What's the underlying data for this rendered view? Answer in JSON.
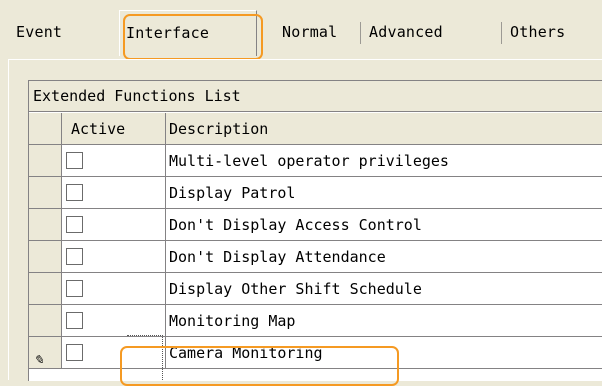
{
  "tabs": [
    {
      "label": "Event"
    },
    {
      "label": "Interface"
    },
    {
      "label": "Normal"
    },
    {
      "label": "Advanced"
    },
    {
      "label": "Others"
    }
  ],
  "grid": {
    "caption": "Extended Functions List",
    "columns": {
      "active": "Active",
      "description": "Description"
    },
    "rows": [
      {
        "description": "Multi-level operator privileges",
        "checked": false
      },
      {
        "description": "Display Patrol",
        "checked": false
      },
      {
        "description": "Don't Display Access Control",
        "checked": false
      },
      {
        "description": "Don't Display Attendance",
        "checked": false
      },
      {
        "description": "Display Other Shift Schedule",
        "checked": false
      },
      {
        "description": "Monitoring Map",
        "checked": false
      },
      {
        "description": "Camera Monitoring",
        "checked": false
      }
    ]
  },
  "icons": {
    "edit_indicator": "pencil-icon"
  },
  "colors": {
    "highlight": "#f59a23",
    "window_bg": "#ece9d8"
  }
}
